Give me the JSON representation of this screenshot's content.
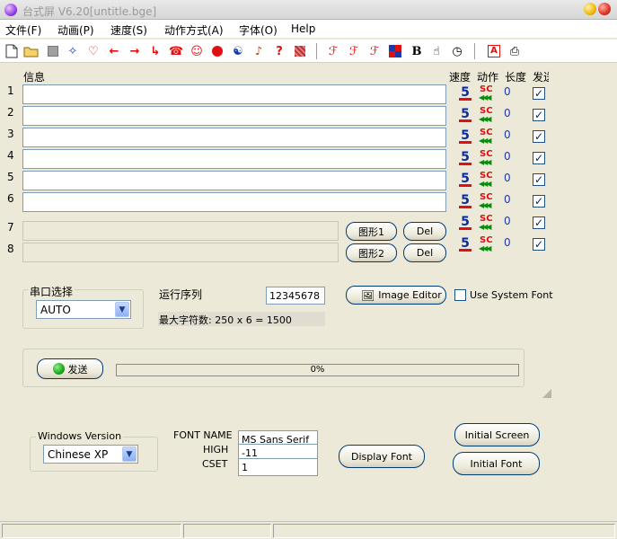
{
  "window": {
    "title": "台式屏 V6.20[untitle.bge]"
  },
  "menu": [
    "文件(F)",
    "动画(P)",
    "速度(S)",
    "动作方式(A)",
    "字体(O)",
    "Help"
  ],
  "toolbar_icons": [
    "new-file-icon",
    "open-folder-icon",
    "stop-square-icon",
    "sparkle-icon",
    "heart-icon",
    "arrow-left-icon",
    "arrow-right-icon",
    "phone-icon",
    "smiley-icon",
    "record-dot-icon",
    "yin-yang-icon",
    "music-note-icon",
    "question-icon",
    "pattern-icon",
    "font-f-icon",
    "font-f2-icon",
    "font-f3-icon",
    "color-grid-icon",
    "bold-icon",
    "hand-arrow-icon",
    "clock-icon",
    "text-a-icon",
    "printer-icon"
  ],
  "grid": {
    "headers": {
      "message": "信息",
      "speed": "速度",
      "action": "动作",
      "length": "长度",
      "send": "发送"
    },
    "rows": [
      {
        "num": "1",
        "text": "",
        "speed": "5",
        "action": "SC",
        "length": "0",
        "send": true
      },
      {
        "num": "2",
        "text": "",
        "speed": "5",
        "action": "SC",
        "length": "0",
        "send": true
      },
      {
        "num": "3",
        "text": "",
        "speed": "5",
        "action": "SC",
        "length": "0",
        "send": true
      },
      {
        "num": "4",
        "text": "",
        "speed": "5",
        "action": "SC",
        "length": "0",
        "send": true
      },
      {
        "num": "5",
        "text": "",
        "speed": "5",
        "action": "SC",
        "length": "0",
        "send": true
      },
      {
        "num": "6",
        "text": "",
        "speed": "5",
        "action": "SC",
        "length": "0",
        "send": true
      },
      {
        "num": "7",
        "text": "",
        "speed": "5",
        "action": "SC",
        "length": "0",
        "send": true
      },
      {
        "num": "8",
        "text": "",
        "speed": "5",
        "action": "SC",
        "length": "0",
        "send": true
      }
    ],
    "graphic_buttons": [
      "图形1",
      "图形2"
    ],
    "del_label": "Del"
  },
  "serial": {
    "group_title": "串口选择",
    "port": "AUTO"
  },
  "sequence": {
    "label": "运行序列",
    "value": "12345678",
    "max_chars": "最大字符数: 250 x 6 = 1500"
  },
  "image_editor_label": "Image Editor",
  "use_system_font_label": "Use System Font",
  "send": {
    "button": "发送",
    "progress_text": "0%",
    "progress": 0
  },
  "windows_version": {
    "group_title": "Windows Version",
    "value": "Chinese XP"
  },
  "font": {
    "name_label": "FONT NAME",
    "name_value": "MS Sans Serif",
    "high_label": "HIGH",
    "high_value": "-11",
    "cset_label": "CSET",
    "cset_value": "1"
  },
  "buttons": {
    "display_font": "Display Font",
    "initial_screen": "Initial Screen",
    "initial_font": "Initial Font"
  },
  "colors": {
    "speed_digit": "#0a2aa8",
    "action_sc": "#e01010",
    "action_arrows": "#0a8a0a",
    "send_green": "#1aa81a"
  }
}
